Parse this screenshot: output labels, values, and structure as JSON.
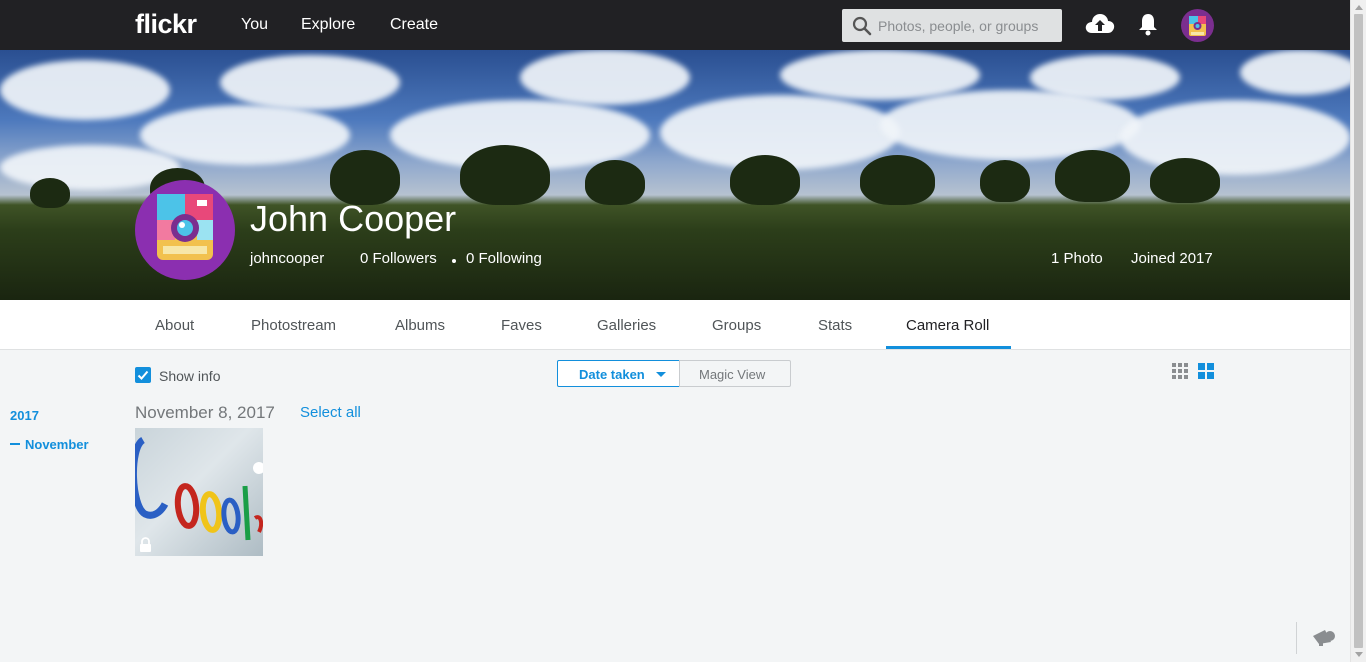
{
  "topbar": {
    "logo": "flickr",
    "nav": [
      "You",
      "Explore",
      "Create"
    ],
    "search_placeholder": "Photos, people, or groups"
  },
  "profile": {
    "name": "John Cooper",
    "username": "johncooper",
    "followers": "0 Followers",
    "following": "0 Following",
    "photos": "1 Photo",
    "joined": "Joined 2017"
  },
  "tabs": [
    "About",
    "Photostream",
    "Albums",
    "Faves",
    "Galleries",
    "Groups",
    "Stats",
    "Camera Roll"
  ],
  "active_tab": "Camera Roll",
  "controls": {
    "show_info": "Show info",
    "show_info_checked": true,
    "date_taken": "Date taken",
    "magic_view": "Magic View"
  },
  "timeline": {
    "year": "2017",
    "month": "November"
  },
  "group": {
    "date": "November 8, 2017",
    "select_all": "Select all"
  },
  "colors": {
    "accent": "#128fdc",
    "topbar": "#212124",
    "background": "#f3f5f6"
  }
}
